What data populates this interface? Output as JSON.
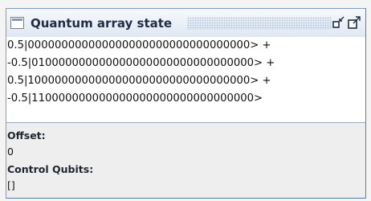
{
  "window": {
    "title": "Quantum array state",
    "icon": "window-icon",
    "buttons": [
      "minimize-icon",
      "maximize-icon"
    ]
  },
  "state": {
    "lines": [
      "0.5|000000000000000000000000000000000> +",
      "-0.5|010000000000000000000000000000000> +",
      "0.5|100000000000000000000000000000000> +",
      "-0.5|110000000000000000000000000000000>"
    ]
  },
  "offset": {
    "label": "Offset:",
    "value": "0"
  },
  "control_qubits": {
    "label": "Control Qubits:",
    "value": "[]"
  },
  "colors": {
    "title_text": "#1f2d44",
    "border": "#7e9bc9",
    "panel_bg": "#eeeeee",
    "text_bg": "#ffffff"
  }
}
